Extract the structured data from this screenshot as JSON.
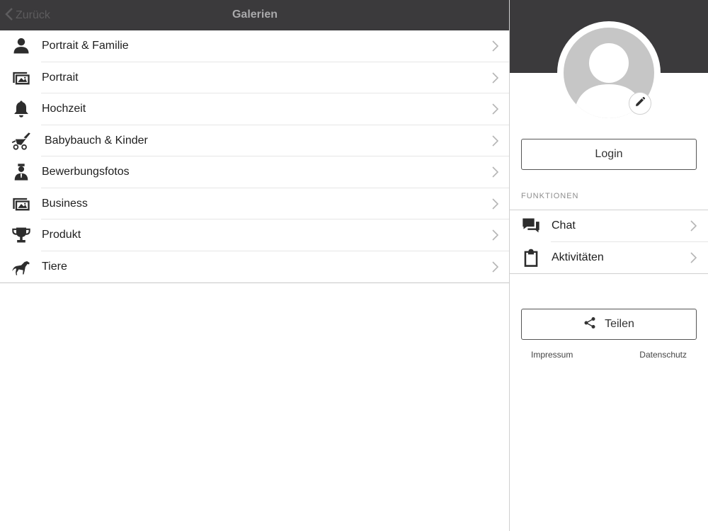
{
  "navbar": {
    "back_label": "Zurück",
    "title": "Galerien"
  },
  "galleries": [
    {
      "label": "Portrait & Familie",
      "icon": "person-icon"
    },
    {
      "label": "Portrait",
      "icon": "images-icon"
    },
    {
      "label": "Hochzeit",
      "icon": "bell-icon"
    },
    {
      "label": "Babybauch & Kinder",
      "icon": "stroller-icon"
    },
    {
      "label": "Bewerbungsfotos",
      "icon": "businessman-icon"
    },
    {
      "label": "Business",
      "icon": "images-icon"
    },
    {
      "label": "Produkt",
      "icon": "trophy-icon"
    },
    {
      "label": "Tiere",
      "icon": "horse-icon"
    }
  ],
  "profile": {
    "login_label": "Login",
    "section_title": "FUNKTIONEN",
    "functions": [
      {
        "label": "Chat",
        "icon": "chat-icon"
      },
      {
        "label": "Aktivitäten",
        "icon": "clipboard-icon"
      }
    ],
    "share_label": "Teilen",
    "footer": {
      "impressum": "Impressum",
      "datenschutz": "Datenschutz"
    }
  },
  "colors": {
    "header_bg": "#3b3a3c",
    "title_text": "#a9a9ab",
    "avatar_bg": "#c6c6c6"
  }
}
